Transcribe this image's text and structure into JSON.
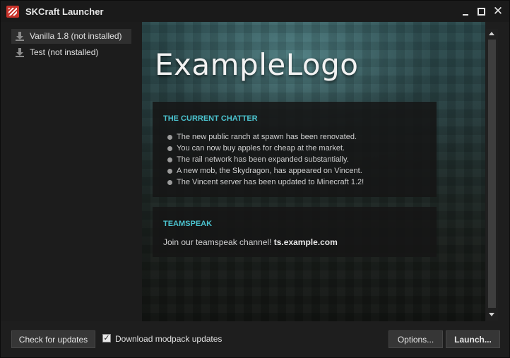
{
  "window": {
    "title": "SKCraft Launcher",
    "close_glyph": "✕"
  },
  "sidebar": {
    "items": [
      {
        "label": "Vanilla 1.8 (not installed)",
        "icon": "download-icon",
        "selected": true
      },
      {
        "label": "Test (not installed)",
        "icon": "download-icon",
        "selected": false
      }
    ]
  },
  "main": {
    "logo_text": "ExampleLogo",
    "news": {
      "heading": "THE CURRENT CHATTER",
      "items": [
        "The new public ranch at spawn has been renovated.",
        "You can now buy apples for cheap at the market.",
        "The rail network has been expanded substantially.",
        "A new mob, the Skydragon, has appeared on Vincent.",
        "The Vincent server has been updated to Minecraft 1.2!"
      ]
    },
    "teamspeak": {
      "heading": "TEAMSPEAK",
      "text": "Join our teamspeak channel! ",
      "host": "ts.example.com"
    }
  },
  "footer": {
    "check_updates_label": "Check for updates",
    "download_modpack_label": "Download modpack updates",
    "download_modpack_checked": true,
    "check_glyph": "✓",
    "options_label": "Options...",
    "launch_label": "Launch..."
  },
  "colors": {
    "accent": "#4bc3cf",
    "window_bg": "#1e1e1e",
    "button_bg": "#363636"
  }
}
